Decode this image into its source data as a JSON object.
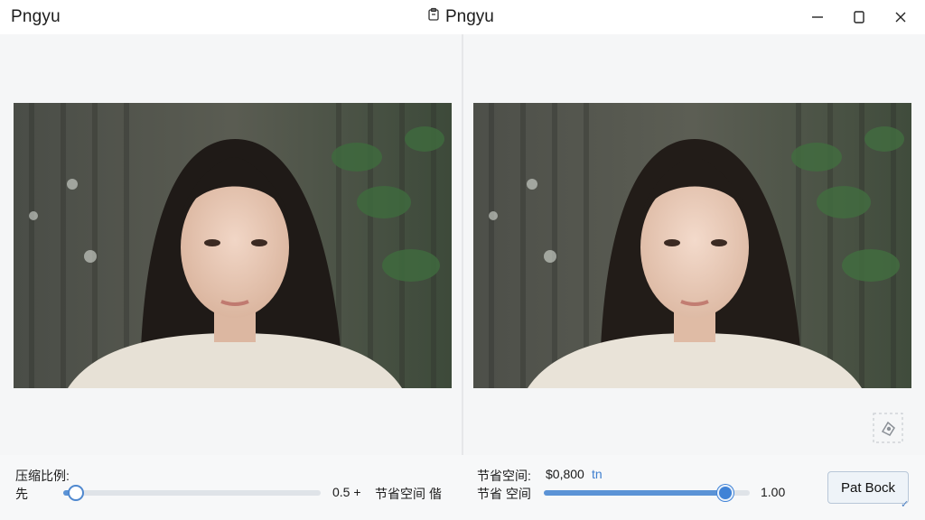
{
  "window": {
    "app_name": "Pngyu",
    "center_title": "Pngyu"
  },
  "left_panel": {
    "ratio_label": "压缩比例:",
    "slider_left_label": "先",
    "slider_value": 0.05,
    "value_text": "0.5 +",
    "save_label": "节省空间 偕"
  },
  "right_panel": {
    "saved_label": "节省空间:",
    "saved_value": "$0,800",
    "saved_unit": "tn",
    "slider_left_label": "节省 空间",
    "slider_value": 0.88,
    "value_text": "1.00"
  },
  "action": {
    "button_label": "Pat Bock",
    "check": "✓"
  },
  "icons": {
    "clipboard": "clipboard-icon",
    "minimize": "minimize-icon",
    "maximize": "maximize-icon",
    "close": "close-icon",
    "corner": "pin-icon"
  },
  "colors": {
    "accent": "#5b93d6",
    "thumb_blue": "#3f82d6"
  }
}
